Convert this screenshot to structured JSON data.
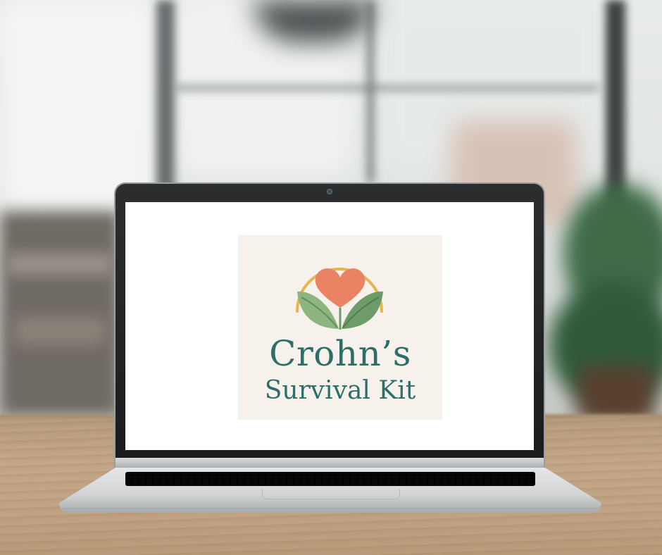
{
  "logo": {
    "title_line1": "Crohn’s",
    "title_line2": "Survival Kit",
    "icon": "heart-with-leaves-icon"
  },
  "colors": {
    "brand_text": "#2e6e69",
    "heart": "#ea8363",
    "leaf_light": "#8eb57f",
    "leaf_dark": "#5f8f5f",
    "arc": "#e7b54f",
    "card_background": "#f6f1ea"
  }
}
